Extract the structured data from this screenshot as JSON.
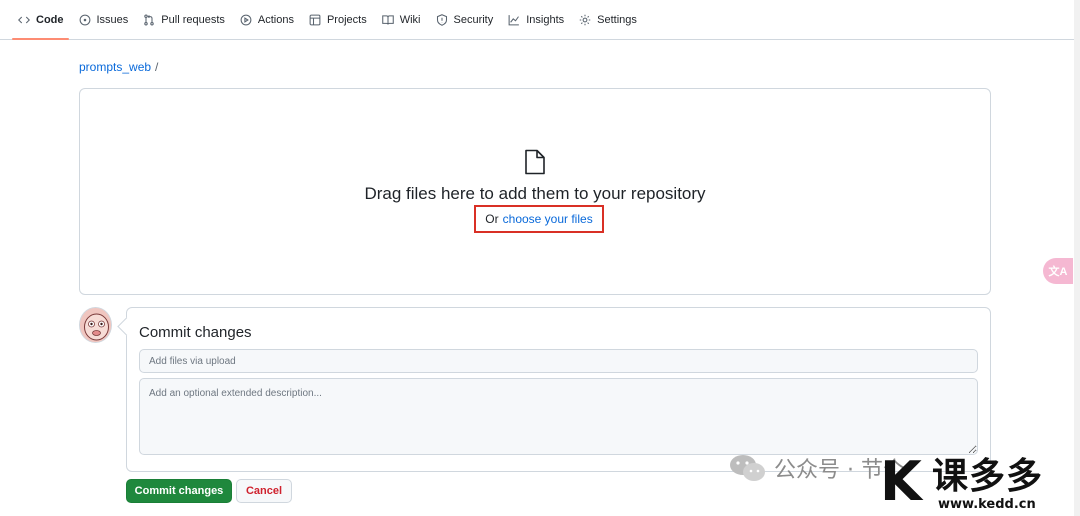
{
  "nav": {
    "items": [
      {
        "label": "Code",
        "icon": "code-icon",
        "selected": true
      },
      {
        "label": "Issues",
        "icon": "issue-icon"
      },
      {
        "label": "Pull requests",
        "icon": "pull-request-icon"
      },
      {
        "label": "Actions",
        "icon": "play-icon"
      },
      {
        "label": "Projects",
        "icon": "table-icon"
      },
      {
        "label": "Wiki",
        "icon": "book-icon"
      },
      {
        "label": "Security",
        "icon": "shield-icon"
      },
      {
        "label": "Insights",
        "icon": "graph-icon"
      },
      {
        "label": "Settings",
        "icon": "gear-icon"
      }
    ]
  },
  "breadcrumb": {
    "repo": "prompts_web",
    "separator": "/"
  },
  "dropzone": {
    "title": "Drag files here to add them to your repository",
    "or_text": "Or",
    "choose_link": "choose your files",
    "highlight_color": "#d93025"
  },
  "commit": {
    "title": "Commit changes",
    "summary_placeholder": "Add files via upload",
    "description_placeholder": "Add an optional extended description...",
    "commit_button": "Commit changes",
    "cancel_button": "Cancel"
  },
  "floating": {
    "translate_label": "文A"
  },
  "watermark": {
    "wechat_text": "公众号 · 节个",
    "brand_k": "K",
    "brand_cn": "课多多",
    "brand_url": "www.kedd.cn"
  },
  "colors": {
    "primary_green": "#1f883d",
    "link_blue": "#0969da",
    "danger_red": "#cf222e",
    "tab_underline": "#fd8c73"
  }
}
